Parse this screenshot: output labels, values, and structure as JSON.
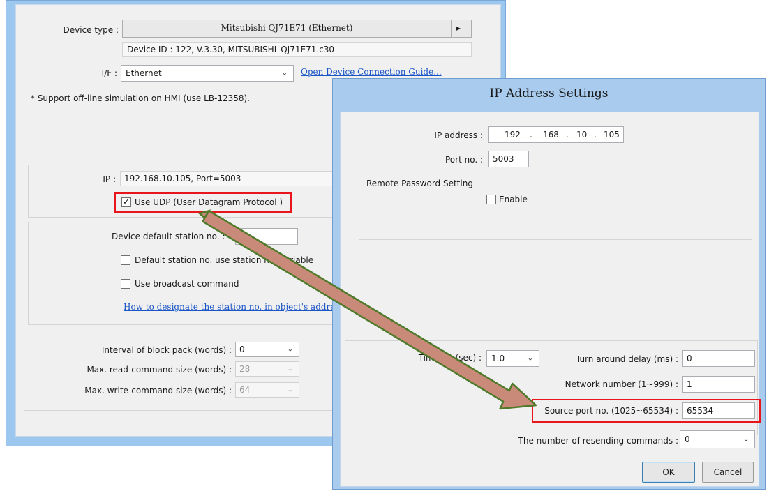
{
  "device_window": {
    "device_type_label": "Device type :",
    "device_type_value": "Mitsubishi QJ71E71 (Ethernet)",
    "device_type_arrow": "▸",
    "device_id": "Device ID : 122, V.3.30, MITSUBISHI_QJ71E71.c30",
    "if_label": "I/F :",
    "if_value": "Ethernet",
    "open_guide_link": "Open Device Connection Guide...",
    "support_note": "* Support off-line simulation on HMI (use LB-12358).",
    "ip_label": "IP :",
    "ip_value": "192.168.10.105,  Port=5003",
    "use_udp_label": "Use UDP (User Datagram Protocol )",
    "use_udp_checked": true,
    "default_station_label": "Device default station no. :",
    "default_station_value": "2",
    "default_station_var_label": "Default station no. use station no. variable",
    "broadcast_label": "Use broadcast command",
    "designate_link": "How to designate the station no. in object's address",
    "interval_label": "Interval of block pack (words) :",
    "interval_value": "0",
    "max_read_label": "Max. read-command size (words) :",
    "max_read_value": "28",
    "max_write_label": "Max. write-command size (words) :",
    "max_write_value": "64"
  },
  "ip_dialog": {
    "title": "IP Address Settings",
    "ip_label": "IP address :",
    "ip_octets": [
      "192",
      "168",
      "10",
      "105"
    ],
    "ip_dot": ".",
    "port_label": "Port no. :",
    "port_value": "5003",
    "remote_pw_label": "Remote Password Setting",
    "enable_label": "Enable",
    "timeout_label": "Timeout (sec) :",
    "timeout_value": "1.0",
    "turnaround_label": "Turn around delay (ms) :",
    "turnaround_value": "0",
    "network_label": "Network number (1~999) :",
    "network_value": "1",
    "source_port_label": "Source port no. (1025~65534) :",
    "source_port_value": "65534",
    "resend_label": "The number of resending commands :",
    "resend_value": "0",
    "ok_label": "OK",
    "cancel_label": "Cancel"
  },
  "icons": {
    "dropdown": "⌄",
    "check": "✓"
  },
  "colors": {
    "highlight_red": "#e8161c",
    "window_frame": "#9cc7ee",
    "arrow_fill": "#c98a7a",
    "arrow_stroke": "#4f7a2a"
  }
}
